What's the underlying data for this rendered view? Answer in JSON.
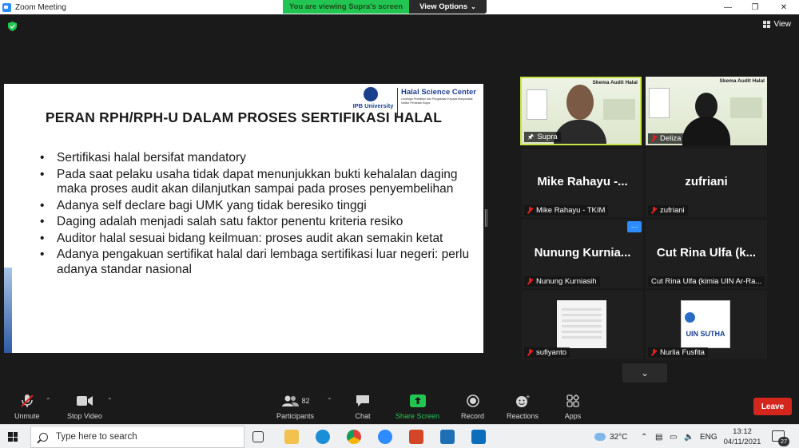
{
  "window": {
    "title": "Zoom Meeting"
  },
  "banner": {
    "viewing": "You are viewing Supra's screen",
    "view_options": "View Options"
  },
  "view_button": {
    "label": "View"
  },
  "slide": {
    "logo_ipb": "IPB University",
    "logo_hsc": "Halal Science Center",
    "logo_hsc_sub": "Lembaga Penelitian dan Pengabdian Kepada Masyarakat Institut Pertanian Bogor",
    "heading": "PERAN RPH/RPH-U DALAM PROSES SERTIFIKASI HALAL",
    "bullets": [
      "Sertifikasi halal bersifat mandatory",
      "Pada saat pelaku usaha tidak dapat menunjukkan bukti kehalalan daging maka proses audit akan dilanjutkan sampai pada proses penyembelihan",
      "Adanya self declare bagi UMK yang tidak beresiko tinggi",
      "Daging adalah menjadi salah satu faktor penentu kriteria resiko",
      "Auditor halal sesuai bidang keilmuan: proses audit akan semakin ketat",
      "Adanya pengakuan sertifikat halal dari lembaga sertifikasi luar negeri: perlu adanya standar nasional"
    ]
  },
  "gallery": {
    "tiles": [
      {
        "label": "Supra",
        "banner": "Skema Audit Halal"
      },
      {
        "label": "Deliza",
        "banner": "Skema Audit Halal"
      },
      {
        "big": "Mike Rahayu -...",
        "label": "Mike Rahayu - TKIM"
      },
      {
        "big": "zufriani",
        "label": "zufriani"
      },
      {
        "big": "Nunung Kurnia...",
        "label": "Nunung Kurniasih"
      },
      {
        "big": "Cut Rina Ulfa (k...",
        "label": "Cut Rina Ulfa (kimia UIN Ar-Ra..."
      },
      {
        "label": "sufiyanto"
      },
      {
        "label": "Nurlia Fusfita",
        "thumb_text": "UIN SUTHA"
      }
    ],
    "more_dots": "…"
  },
  "toolbar": {
    "unmute": "Unmute",
    "stop_video": "Stop Video",
    "participants": "Participants",
    "participants_count": "82",
    "chat": "Chat",
    "share_screen": "Share Screen",
    "record": "Record",
    "reactions": "Reactions",
    "apps": "Apps",
    "leave": "Leave"
  },
  "taskbar": {
    "search_placeholder": "Type here to search",
    "temperature": "32°C",
    "language": "ENG",
    "time": "13:12",
    "date": "04/11/2021",
    "notification_count": "27"
  },
  "colors": {
    "active_speaker_border": "#c6e64a",
    "banner_green": "#23c552",
    "leave_red": "#d3271e",
    "share_green": "#23c552",
    "mute_red": "#e02020"
  }
}
